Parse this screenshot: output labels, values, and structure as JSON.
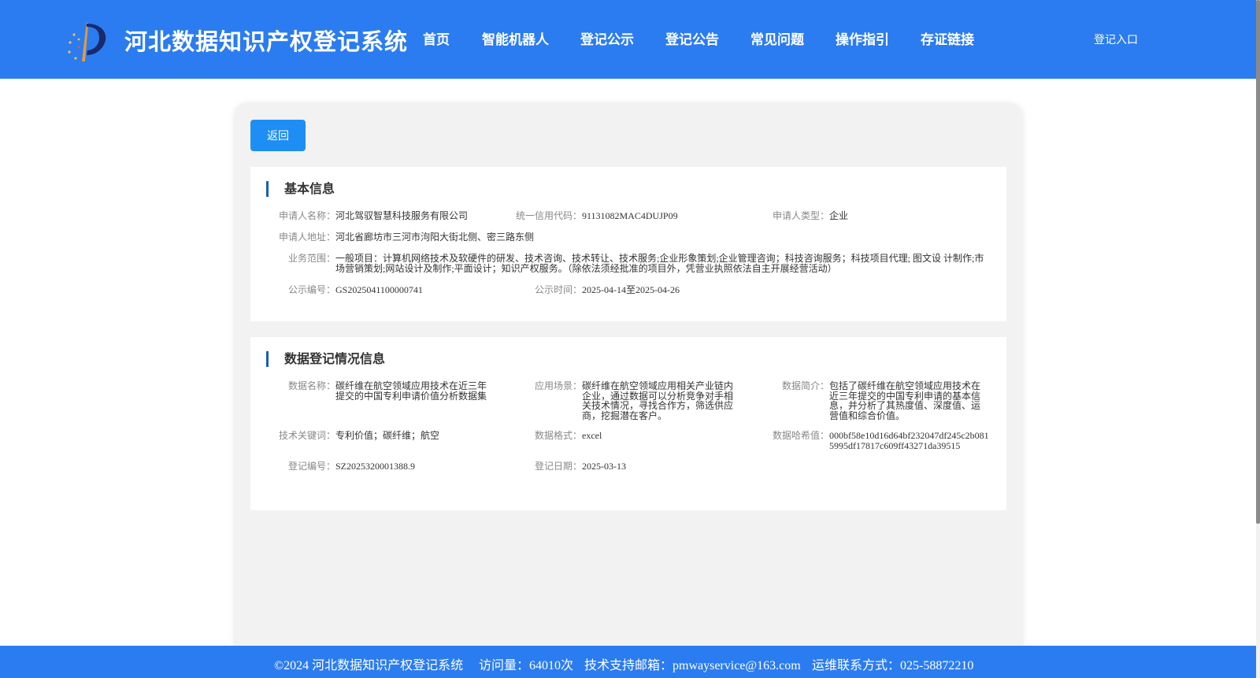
{
  "header": {
    "site_title": "河北数据知识产权登记系统",
    "nav": [
      "首页",
      "智能机器人",
      "登记公示",
      "登记公告",
      "常见问题",
      "操作指引",
      "存证链接"
    ],
    "login": "登记入口"
  },
  "main": {
    "back_label": "返回",
    "basic": {
      "title": "基本信息",
      "applicant_name_label": "申请人名称：",
      "applicant_name": "河北驾驭智慧科技服务有限公司",
      "credit_code_label": "统一信用代码：",
      "credit_code": "91131082MAC4DUJP09",
      "applicant_type_label": "申请人类型：",
      "applicant_type": "企业",
      "address_label": "申请人地址：",
      "address": "河北省廊坊市三河市泃阳大街北侧、密三路东侧",
      "scope_label": "业务范围：",
      "scope": "一般项目：计算机网络技术及软硬件的研发、技术咨询、技术转让、技术服务;企业形象策划;企业管理咨询；科技咨询服务；科技项目代理; 图文设 计制作;市场营销策划;网站设计及制作;平面设计；知识产权服务。（除依法须经批准的项目外，凭营业执照依法自主开展经营活动）",
      "pub_no_label": "公示编号：",
      "pub_no": "GS2025041100000741",
      "pub_time_label": "公示时间：",
      "pub_time": "2025-04-14至2025-04-26"
    },
    "registration": {
      "title": "数据登记情况信息",
      "data_name_label": "数据名称：",
      "data_name": "碳纤维在航空领域应用技术在近三年提交的中国专利申请价值分析数据集",
      "scenario_label": "应用场景：",
      "scenario": "碳纤维在航空领域应用相关产业链内企业，通过数据可以分析竞争对手相关技术情况，寻找合作方，筛选供应商，挖掘潜在客户。",
      "intro_label": "数据简介：",
      "intro": "包括了碳纤维在航空领域应用技术在近三年提交的中国专利申请的基本信息，并分析了其热度值、深度值、运营值和综合价值。",
      "keywords_label": "技术关键词：",
      "keywords": "专利价值；碳纤维；航空",
      "format_label": "数据格式：",
      "format": "excel",
      "hash_label": "数据哈希值：",
      "hash": "000bf58e10d16d64bf232047df245c2b0815995df17817c609ff43271da39515",
      "reg_no_label": "登记编号：",
      "reg_no": "SZ2025320001388.9",
      "reg_date_label": "登记日期：",
      "reg_date": "2025-03-13"
    }
  },
  "footer": {
    "copyright": "©2024 河北数据知识产权登记系统",
    "visits": "访问量：64010次",
    "email": "技术支持邮箱：pmwayservice@163.com",
    "phone": "运维联系方式：025-58872210"
  },
  "colors": {
    "header_bg": "#2b7cf0",
    "button_bg": "#1e8ef5",
    "title_bar": "#1c5bb8"
  }
}
